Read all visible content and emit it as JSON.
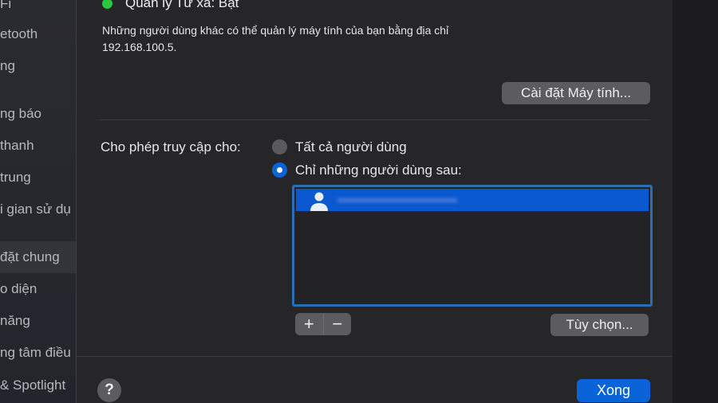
{
  "sidebar": {
    "items": [
      {
        "label": "Fi"
      },
      {
        "label": "etooth"
      },
      {
        "label": "ng"
      },
      {
        "label": "ng báo"
      },
      {
        "label": "thanh"
      },
      {
        "label": " trung"
      },
      {
        "label": "i gian sử dụ"
      },
      {
        "label": "đặt chung",
        "selected": true
      },
      {
        "label": "o diện"
      },
      {
        "label": "năng"
      },
      {
        "label": "ng tâm điều"
      },
      {
        "label": "& Spotlight"
      }
    ]
  },
  "status": {
    "title": "Quản lý Từ xa: Bật",
    "indicator_color": "#2ac840",
    "description_line1": "Những người dùng khác có thể quản lý máy tính của bạn bằng địa chỉ",
    "description_line2": "192.168.100.5."
  },
  "computer_settings_button": "Cài đặt Máy tính...",
  "access": {
    "label": "Cho phép truy cập cho:",
    "options": [
      {
        "label": "Tất cả người dùng",
        "selected": false
      },
      {
        "label": "Chỉ những người dùng sau:",
        "selected": true
      }
    ]
  },
  "user_list": {
    "selected_color": "#0a58d0"
  },
  "add_button": "+",
  "remove_button": "−",
  "options_button": "Tùy chọn...",
  "help_button": "?",
  "done_button": "Xong",
  "accent": "#0a64d8"
}
